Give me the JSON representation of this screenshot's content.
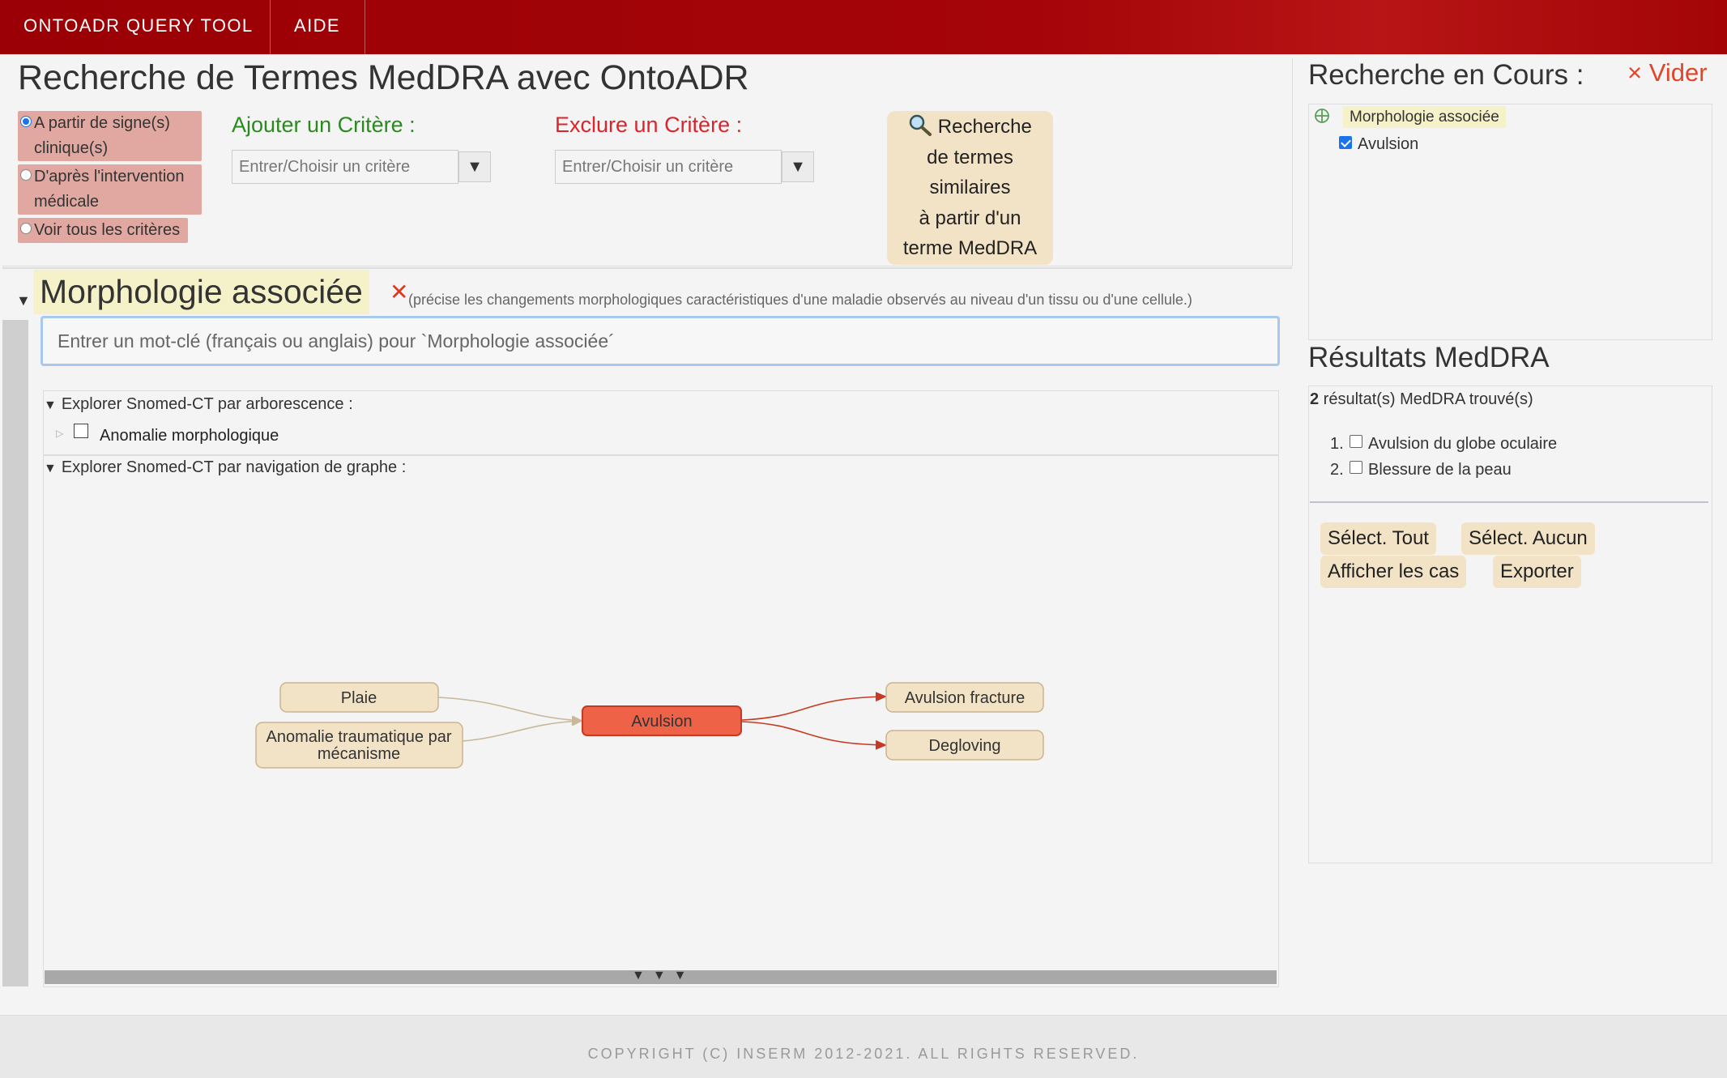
{
  "navbar": {
    "brand": "ONTOADR QUERY TOOL",
    "help": "AIDE"
  },
  "header": {
    "title": "Recherche de Termes MedDRA avec OntoADR",
    "mode_options": [
      {
        "label": "A partir de signe(s) clinique(s)",
        "selected": true
      },
      {
        "label": "D'après l'intervention médicale",
        "selected": false
      },
      {
        "label": "Voir tous les critères",
        "selected": false
      }
    ],
    "add_criterion": {
      "label": "Ajouter un Critère :",
      "placeholder": "Entrer/Choisir un critère",
      "color": "#2a8a1f"
    },
    "exclude_criterion": {
      "label": "Exclure un Critère :",
      "placeholder": "Entrer/Choisir un critère",
      "color": "#d9252b"
    },
    "similar_search": {
      "icon": "magnifier-icon",
      "lines": [
        "Recherche",
        "de termes",
        "similaires",
        "à partir d'un",
        "terme MedDRA"
      ]
    }
  },
  "criterion": {
    "title": "Morphologie associée",
    "remove_icon": "close-icon",
    "description": "(précise les changements morphologiques caractéristiques d'une maladie observés au niveau d'un tissu ou d'une cellule.)",
    "keyword_placeholder": "Entrer un mot-clé (français ou anglais) pour `Morphologie associée´",
    "tree_explorer": {
      "summary": "Explorer Snomed-CT par arborescence :",
      "nodes": [
        {
          "label": "Anomalie morphologique",
          "checked": false
        }
      ]
    },
    "graph_explorer": {
      "summary": "Explorer Snomed-CT par navigation de graphe :",
      "nodes": {
        "plaie": "Plaie",
        "anomalie": [
          "Anomalie traumatique par",
          "mécanisme"
        ],
        "avulsion": "Avulsion",
        "avulsion_fracture": "Avulsion fracture",
        "degloving": "Degloving"
      },
      "colors": {
        "node_fill": "#f3e3c6",
        "node_stroke": "#c9b48f",
        "center_fill": "#ee6347",
        "center_stroke": "#c53a22",
        "edge_in": "#c8b79a",
        "edge_out": "#c53a22"
      }
    },
    "resize_grip": "▼▼▼"
  },
  "current_search": {
    "title": "Recherche en Cours :",
    "clear_label": "× Vider",
    "criterion": "Morphologie associée",
    "values": [
      {
        "label": "Avulsion",
        "checked": true
      }
    ]
  },
  "results": {
    "title": "Résultats MedDRA",
    "count": "2",
    "count_suffix": " résultat(s) MedDRA trouvé(s)",
    "items": [
      {
        "num": "1.",
        "label": "Avulsion du globe oculaire",
        "checked": false
      },
      {
        "num": "2.",
        "label": "Blessure de la peau",
        "checked": false
      }
    ],
    "buttons": {
      "select_all": "Sélect. Tout",
      "select_none": "Sélect. Aucun",
      "show_cases": "Afficher les cas",
      "export": "Exporter"
    }
  },
  "footer": {
    "copyright": "COPYRIGHT (C) INSERM 2012-2021. ALL RIGHTS RESERVED."
  }
}
